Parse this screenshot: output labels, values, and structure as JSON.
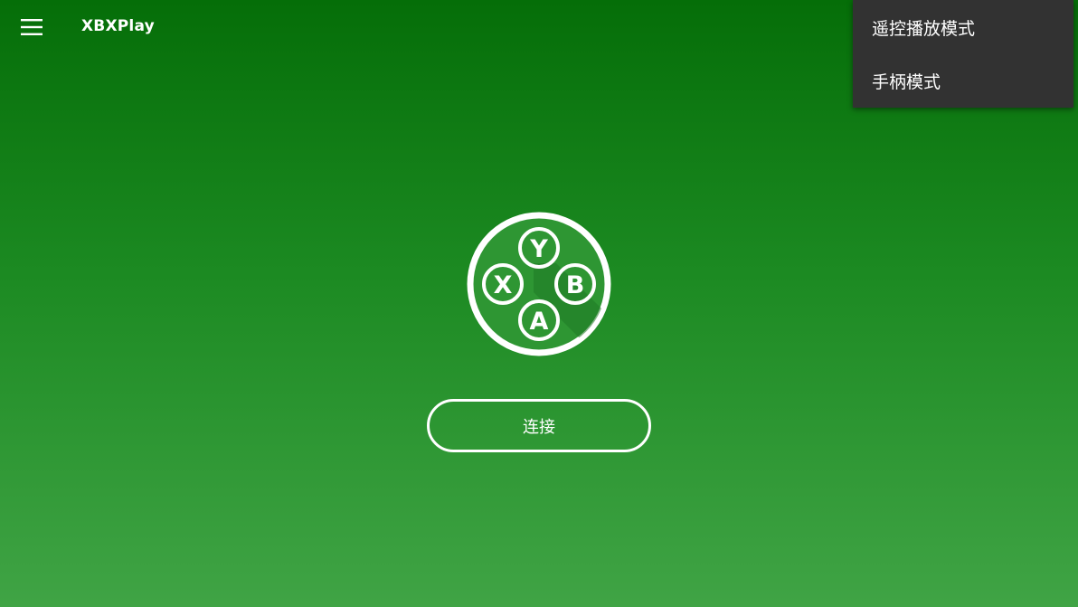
{
  "app_bar": {
    "title": "XBXPlay",
    "menu_icon": "hamburger-menu-icon"
  },
  "logo": {
    "icon": "controller-buttons-logo-icon",
    "buttons": {
      "top": "Y",
      "left": "X",
      "right": "B",
      "bottom": "A"
    }
  },
  "main": {
    "connect_label": "连接"
  },
  "popup_menu": {
    "items": [
      {
        "label": "遥控播放模式"
      },
      {
        "label": "手柄模式"
      }
    ]
  },
  "colors": {
    "background_top": "#056e08",
    "background_bottom": "#40a445",
    "logo_fill": "#2e9633",
    "popup_background": "#323232",
    "foreground": "#ffffff"
  }
}
